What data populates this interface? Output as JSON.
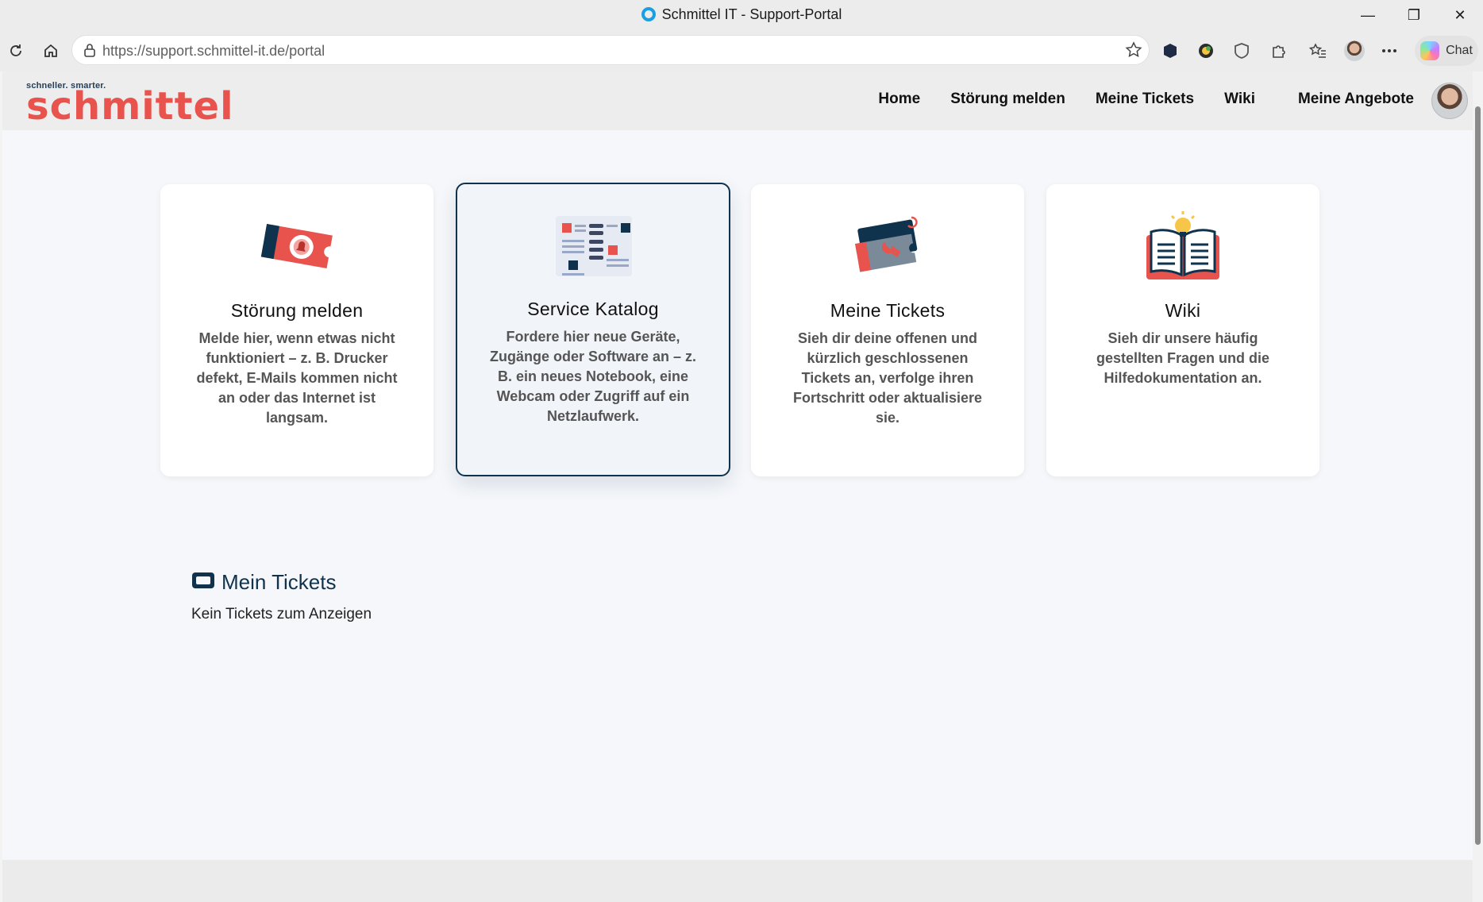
{
  "browser": {
    "window_title": "Schmittel IT - Support-Portal",
    "url_host": "https://support.schmittel-it.de",
    "url_path": "/portal",
    "chat_label": "Chat",
    "accent": "#1a9fe0"
  },
  "site": {
    "logo_tagline": "schneller. smarter.",
    "logo_word": "schmittel",
    "brand_color": "#e8534d",
    "dark_color": "#10334d",
    "nav": [
      {
        "label": "Home"
      },
      {
        "label": "Störung melden"
      },
      {
        "label": "Meine Tickets"
      },
      {
        "label": "Wiki"
      },
      {
        "label": "Meine Angebote"
      }
    ]
  },
  "cards": [
    {
      "title": "Störung melden",
      "text": "Melde hier, wenn etwas nicht funktioniert – z. B. Drucker defekt, E-Mails kommen nicht an oder das Internet ist langsam.",
      "icon": "ticket-alert-icon"
    },
    {
      "title": "Service Katalog",
      "text": "Fordere hier neue Geräte, Zugänge oder Software an – z. B. ein neues Notebook, eine Webcam oder Zugriff auf ein Netzlaufwerk.",
      "icon": "catalog-icon",
      "active": true
    },
    {
      "title": "Meine Tickets",
      "text": "Sieh dir deine offenen und kürzlich geschlossenen Tickets an, verfolge ihren Fortschritt oder aktualisiere sie.",
      "icon": "ticket-wrench-icon"
    },
    {
      "title": "Wiki",
      "text": "Sieh dir unsere häufig gestellten Fragen und die Hilfedokumentation an.",
      "icon": "book-lightbulb-icon"
    }
  ],
  "my_tickets": {
    "heading": "Mein Tickets",
    "empty_text": "Kein Tickets zum Anzeigen"
  }
}
